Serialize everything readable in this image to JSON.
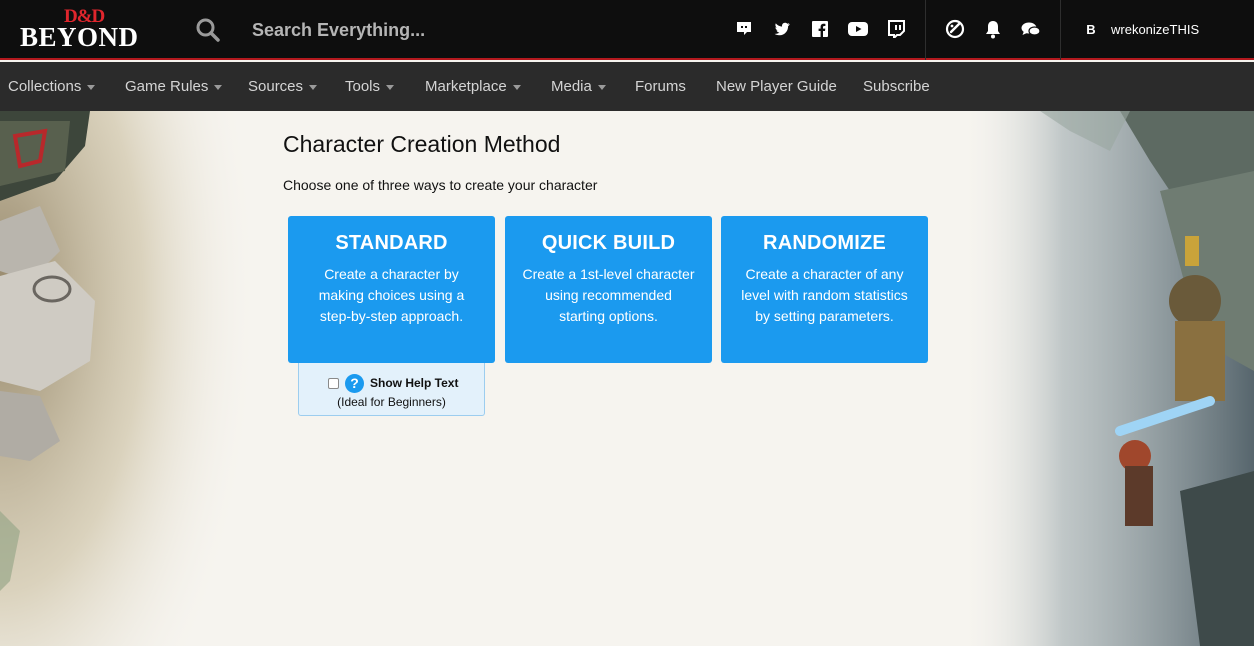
{
  "header": {
    "logo_top": "D&D",
    "logo_bottom": "BEYOND",
    "search_placeholder": "Search Everything...",
    "social_icons": [
      "discord-icon",
      "twitter-icon",
      "facebook-icon",
      "youtube-icon",
      "twitch-icon"
    ],
    "utility_icons": [
      "dice-icon",
      "bell-icon",
      "chat-icon"
    ],
    "user": {
      "avatar_letter": "B",
      "username": "wrekonizeTHIS"
    }
  },
  "nav": {
    "items": [
      {
        "label": "Collections",
        "dropdown": true
      },
      {
        "label": "Game Rules",
        "dropdown": true
      },
      {
        "label": "Sources",
        "dropdown": true
      },
      {
        "label": "Tools",
        "dropdown": true
      },
      {
        "label": "Marketplace",
        "dropdown": true
      },
      {
        "label": "Media",
        "dropdown": true
      },
      {
        "label": "Forums",
        "dropdown": false
      },
      {
        "label": "New Player Guide",
        "dropdown": false
      },
      {
        "label": "Subscribe",
        "dropdown": false
      }
    ]
  },
  "main": {
    "title": "Character Creation Method",
    "subtitle": "Choose one of three ways to create your character",
    "cards": [
      {
        "title": "STANDARD",
        "description": "Create a character by making choices using a step-by-step approach."
      },
      {
        "title": "QUICK BUILD",
        "description": "Create a 1st-level character using recommended starting options."
      },
      {
        "title": "RANDOMIZE",
        "description": "Create a character of any level with random statistics by setting parameters."
      }
    ],
    "help": {
      "label": "Show Help Text",
      "sublabel": "(Ideal for Beginners)",
      "checked": false,
      "icon_glyph": "?"
    }
  },
  "colors": {
    "header_bg": "#0e0e0e",
    "header_accent": "#b3191e",
    "nav_bg": "#2b2b2b",
    "card_bg": "#1b9aef",
    "help_bg": "#e3f1fb",
    "page_bg": "#f6f4ef"
  }
}
